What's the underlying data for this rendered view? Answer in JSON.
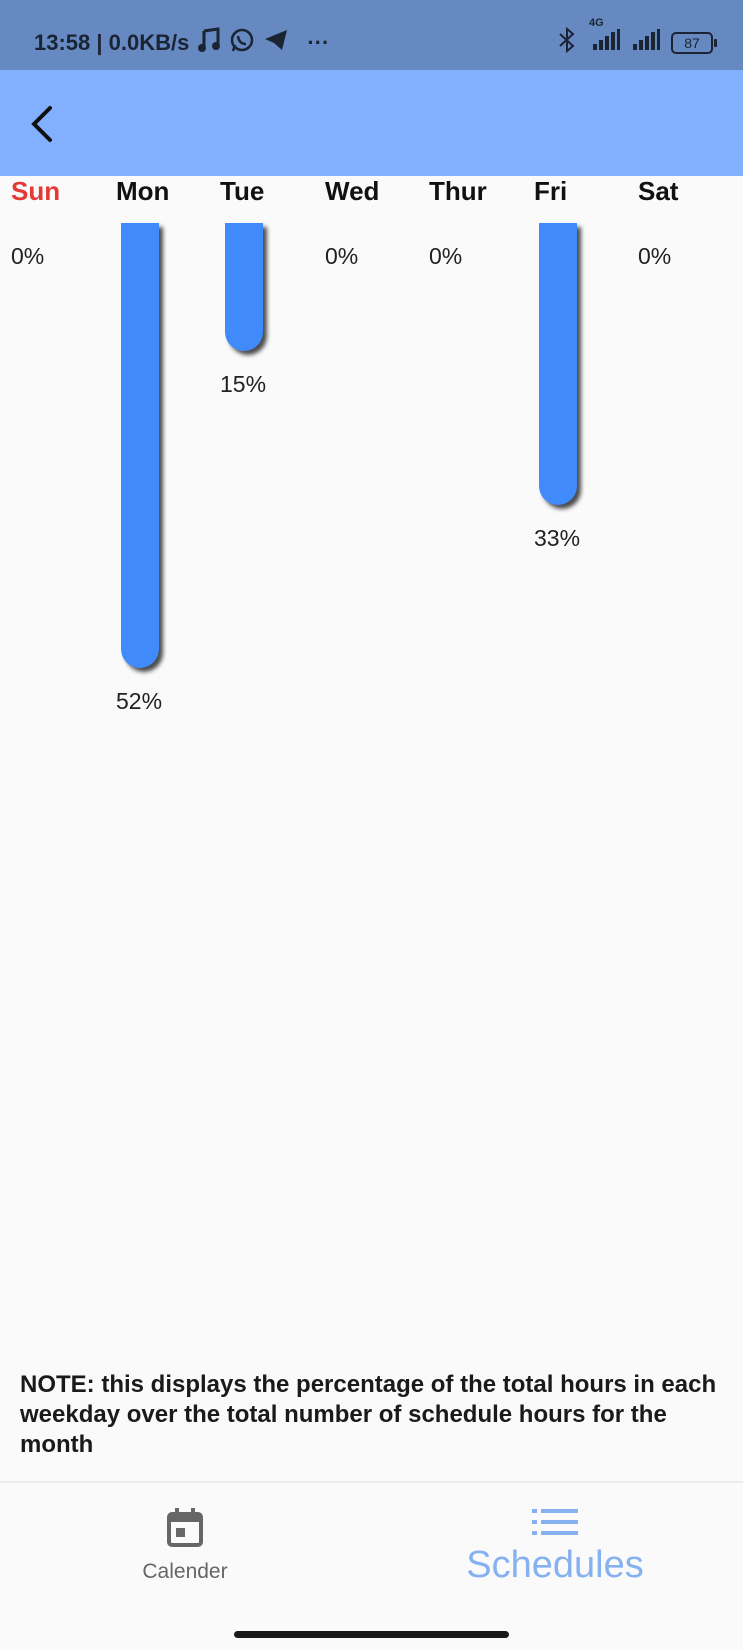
{
  "status_bar": {
    "time_speed": "13:58 | 0.0KB/s",
    "more": "···",
    "network": "4G",
    "battery": "87"
  },
  "days": [
    {
      "label": "Sun",
      "percent": 0,
      "percent_label": "0%",
      "color": "#e53935"
    },
    {
      "label": "Mon",
      "percent": 52,
      "percent_label": "52%",
      "color": "#111111"
    },
    {
      "label": "Tue",
      "percent": 15,
      "percent_label": "15%",
      "color": "#111111"
    },
    {
      "label": "Wed",
      "percent": 0,
      "percent_label": "0%",
      "color": "#111111"
    },
    {
      "label": "Thur",
      "percent": 0,
      "percent_label": "0%",
      "color": "#111111"
    },
    {
      "label": "Fri",
      "percent": 33,
      "percent_label": "33%",
      "color": "#111111"
    },
    {
      "label": "Sat",
      "percent": 0,
      "percent_label": "0%",
      "color": "#111111"
    }
  ],
  "bar_color": "#418afc",
  "note": "NOTE: this displays the percentage of the total hours in each weekday over the total number of schedule hours for the month",
  "nav": {
    "calendar_label": "Calender",
    "schedules_label": "Schedules"
  },
  "colors": {
    "status_bar": "#6689c1",
    "app_bar": "#82b0fe",
    "active_nav": "#86b1f1"
  }
}
